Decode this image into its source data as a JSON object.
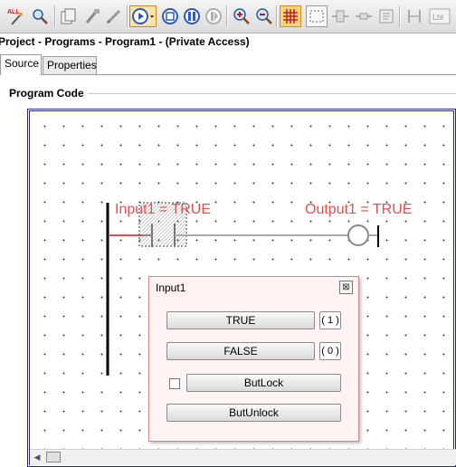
{
  "toolbar": {
    "all_label": "ALL",
    "lbl_label": "Lbl",
    "icons": [
      "wand-all-icon",
      "search-icon",
      "copy-icon",
      "tools-icon",
      "pen-icon",
      "run-icon",
      "stop-icon",
      "pause-icon",
      "step-icon",
      "zoom-in-icon",
      "zoom-out-icon",
      "grid-icon",
      "select-rect-icon",
      "contact-icon",
      "coil-icon",
      "doc-icon",
      "rung-icon",
      "label-icon"
    ]
  },
  "window_title": "Project - Programs - Program1 - (Private Access)",
  "tabs": [
    {
      "label": "Source",
      "selected": true
    },
    {
      "label": "Properties",
      "selected": false
    }
  ],
  "group_label": "Program Code",
  "ladder": {
    "contact_label": "Input1 = TRUE",
    "coil_label": "Output1 = TRUE",
    "active_color": "#e05050"
  },
  "popup": {
    "title": "Input1",
    "close_glyph": "⊠",
    "true_label": "TRUE",
    "true_value": "( 1 )",
    "false_label": "FALSE",
    "false_value": "( 0 )",
    "butlock_label": "ButLock",
    "butunlock_label": "ButUnlock",
    "butlock_checked": false
  },
  "scrollbar": {
    "left_glyph": "◀"
  }
}
